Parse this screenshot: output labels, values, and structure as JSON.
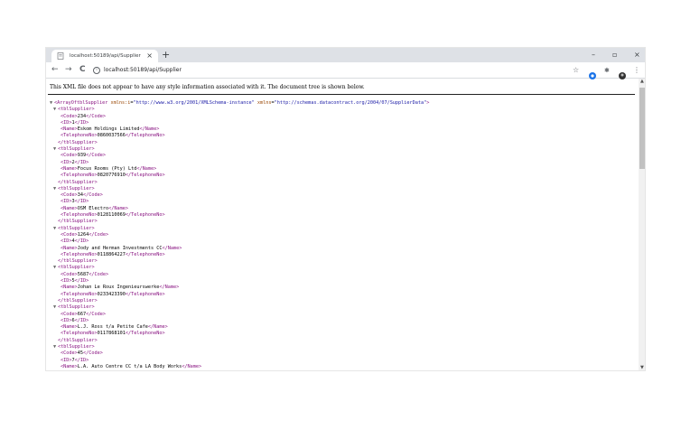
{
  "tab": {
    "title": "localhost:50189/api/Supplier",
    "close_glyph": "×",
    "new_tab_glyph": "+"
  },
  "window_controls": {
    "minimize": "–",
    "maximize": "▫",
    "close": "×"
  },
  "nav": {
    "back": "←",
    "forward": "→",
    "reload": "C"
  },
  "address": {
    "url": "localhost:50189/api/Supplier",
    "info_glyph": "i"
  },
  "toolbar_icons": {
    "star": "☆",
    "menu": "⋮",
    "puzzle": "✱"
  },
  "colors": {
    "tag": "#881280",
    "attr_name": "#994500",
    "attr_value": "#1a1aa6",
    "text": "#000000",
    "ext_hp": "#1a73e8",
    "ext_avatar": "#333333"
  },
  "notice": "This XML file does not appear to have any style information associated with it. The document tree is shown below.",
  "root": {
    "open_start": "<ArrayOftblSupplier",
    "attr1_name": "xmlns:i",
    "attr1_value": "\"http://www.w3.org/2001/XMLSchema-instance\"",
    "attr2_name": "xmlns",
    "attr2_value": "\"http://schemas.datacontract.org/2004/07/SupplierData\"",
    "open_end": ">"
  },
  "tags": {
    "supplier_open": "<tblSupplier>",
    "supplier_close": "</tblSupplier>",
    "code_open": "<Code>",
    "code_close": "</Code>",
    "id_open": "<ID>",
    "id_close": "</ID>",
    "name_open": "<Name>",
    "name_close": "</Name>",
    "tel_open": "<TelephoneNo>",
    "tel_close": "</TelephoneNo>"
  },
  "toggle_glyph": "▼",
  "suppliers": [
    {
      "code": "234",
      "id": "1",
      "name": "Eskom Holdings Limited",
      "tel": "0860037566"
    },
    {
      "code": "939",
      "id": "2",
      "name": "Focus Rooms (Pty) Ltd",
      "tel": "0820776910"
    },
    {
      "code": "34",
      "id": "3",
      "name": "OSM Electro",
      "tel": "0128110069"
    },
    {
      "code": "1264",
      "id": "4",
      "name": "Jody and Herman Investments CC",
      "tel": "0118864227"
    },
    {
      "code": "5687",
      "id": "5",
      "name": "Johan Le Roux Ingenieurswerke",
      "tel": "0233423390"
    },
    {
      "code": "667",
      "id": "6",
      "name": "L.J. Ross t/a Petite Cafe",
      "tel": "0117868101"
    },
    {
      "code": "45",
      "id": "7",
      "name": "L.A. Auto Centre CC t/a LA Body Works",
      "tel": ""
    }
  ]
}
